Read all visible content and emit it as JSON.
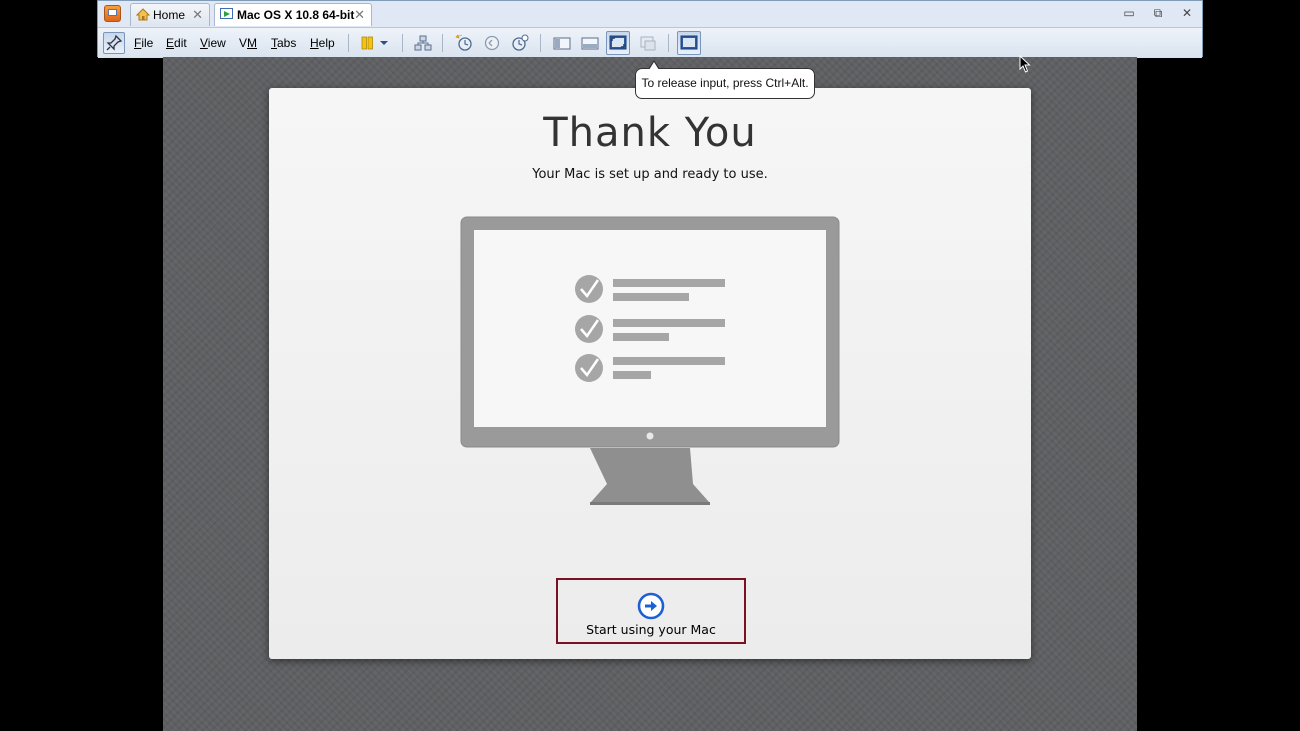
{
  "window": {
    "tabs": [
      {
        "label": "Home",
        "icon": "home-icon"
      },
      {
        "label": "Mac OS X 10.8 64-bit",
        "icon": "vm-running-icon"
      }
    ],
    "close_glyph": "✕",
    "controls": {
      "minimize": "▭",
      "restore": "⧉",
      "close": "✕"
    }
  },
  "toolbar": {
    "menu": [
      "File",
      "Edit",
      "View",
      "VM",
      "Tabs",
      "Help"
    ],
    "menu_underline": [
      "F",
      "E",
      "V",
      "M",
      "T",
      "H"
    ]
  },
  "tooltip": {
    "text": "To release input, press Ctrl+Alt."
  },
  "setup": {
    "title": "Thank You",
    "subtitle": "Your Mac is set up and ready to use.",
    "button_label": "Start using your Mac"
  },
  "colors": {
    "accent_blue": "#1e5fd6",
    "button_border": "#7a1020",
    "guest_background": "#5f6063"
  }
}
